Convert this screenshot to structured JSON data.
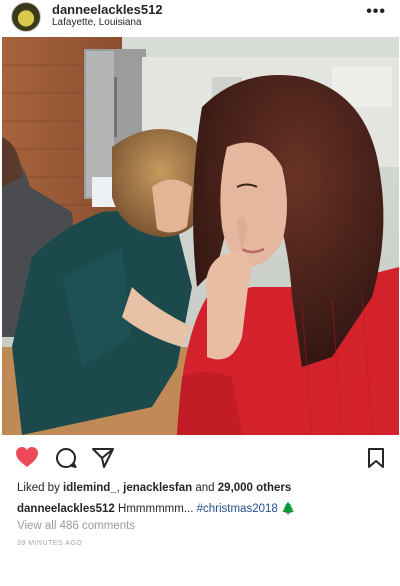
{
  "post": {
    "username": "danneelackles512",
    "location": "Lafayette, Louisiana",
    "more_icon": "more-dots-icon",
    "likes": {
      "prefix": "Liked by",
      "user1": "idlemind_",
      "user2": "jenacklesfan",
      "middle": "and",
      "others": "29,000 others"
    },
    "caption": {
      "user": "danneelackles512",
      "text": "Hmmmmmm...",
      "hashtag": "#christmas2018",
      "emoji": "🌲"
    },
    "view_comments": "View all 486 comments",
    "timestamp": "39 MINUTES AGO"
  },
  "icons": {
    "like": "heart-icon",
    "comment": "comment-icon",
    "share": "share-icon",
    "save": "bookmark-icon"
  },
  "colors": {
    "heart": "#ed4956",
    "text": "#262626",
    "muted": "#9a9a9a",
    "hashtag": "#1f4d8c"
  }
}
